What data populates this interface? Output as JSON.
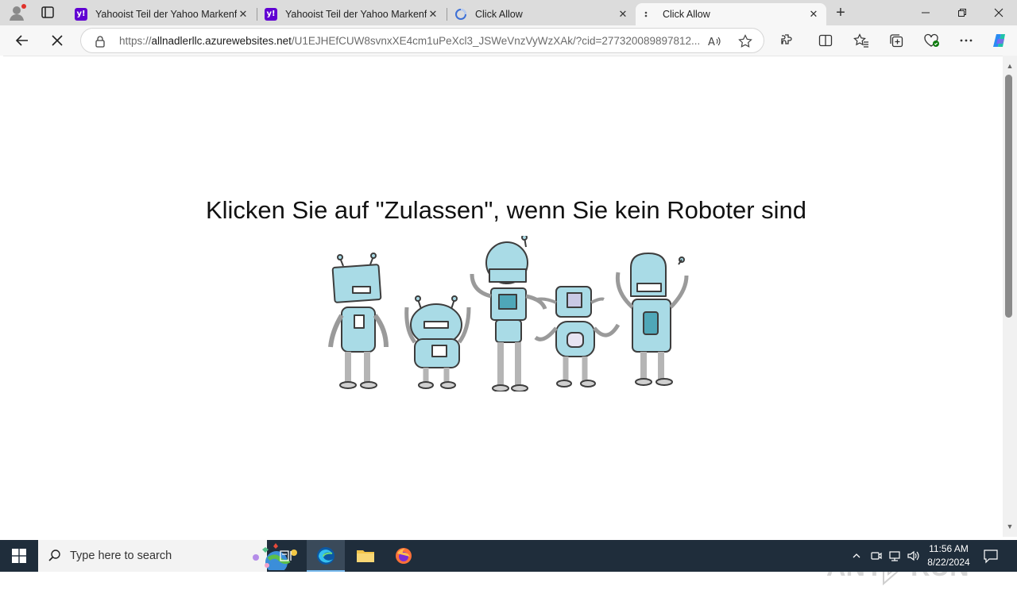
{
  "browser": {
    "tabs": [
      {
        "title": "Yahooist Teil der Yahoo Markenfa",
        "favicon": "yahoo-icon",
        "active": false
      },
      {
        "title": "Yahooist Teil der Yahoo Markenfa",
        "favicon": "yahoo-icon",
        "active": false
      },
      {
        "title": "Click Allow",
        "favicon": "loading-icon",
        "active": false
      },
      {
        "title": "Click Allow",
        "favicon": "loading-dots-icon",
        "active": true
      }
    ],
    "address": {
      "host": "allnadlerllc.azurewebsites.net",
      "scheme": "https://",
      "path": "/U1EJHEfCUW8svnxXE4cm1uPeXcl3_JSWeVnzVyWzXAk/?cid=277320089897812..."
    },
    "accent_color": "#0f6cbd"
  },
  "page": {
    "headline": "Klicken Sie auf \"Zulassen\", wenn Sie kein Roboter sind",
    "image": "robots-illustration",
    "watermark": "ANY RUN"
  },
  "taskbar": {
    "search_placeholder": "Type here to search",
    "time": "11:56 AM",
    "date": "8/22/2024",
    "background": "#1f2d3b"
  }
}
